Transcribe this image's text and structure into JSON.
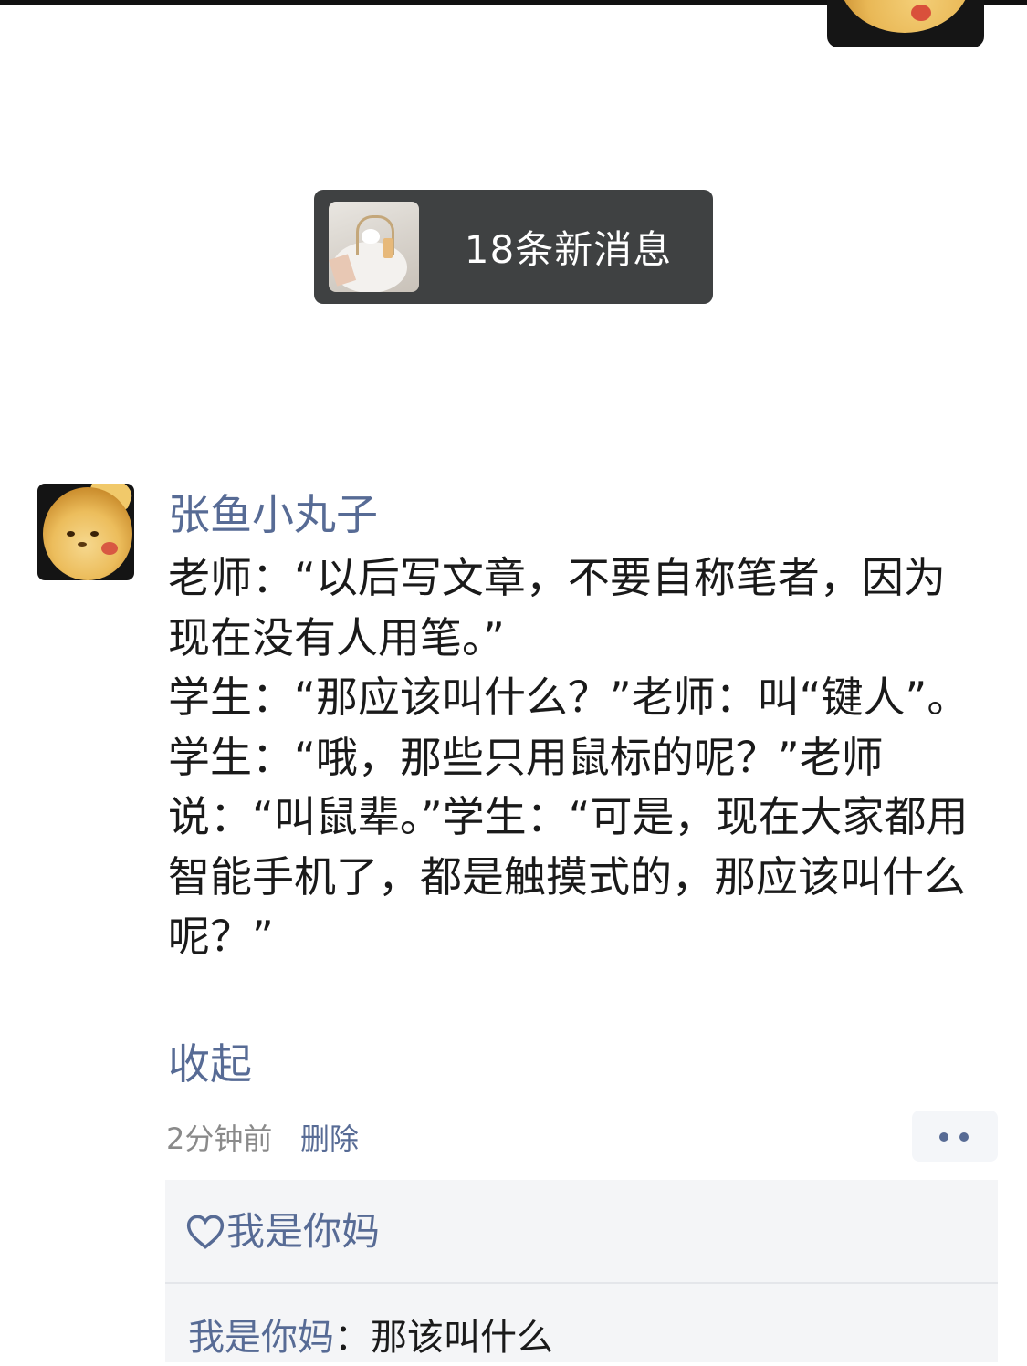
{
  "new_messages": {
    "text": "18条新消息"
  },
  "post": {
    "author": "张鱼小丸子",
    "text": "老师：“以后写文章，不要自称笔者，因为现在没有人用笔。”\n学生：“那应该叫什么？”老师：叫“键人”。\n学生：“哦，那些只用鼠标的呢？”老师说：“叫鼠辈。”学生：“可是，现在大家都用智能手机了，都是触摸式的，那应该叫什么呢？”",
    "collapse_label": "收起",
    "time": "2分钟前",
    "delete_label": "删除"
  },
  "likes": {
    "names": "我是你妈"
  },
  "comments": [
    {
      "author": "我是你妈",
      "separator": "：",
      "text": "那该叫什么"
    }
  ],
  "colors": {
    "link_blue": "#576b95",
    "text": "#1a1a1a",
    "time_gray": "#8a8a8a",
    "interact_bg": "#f4f5f7",
    "banner_bg": "#3f4142"
  },
  "icons": {
    "like": "heart-outline-icon",
    "more": "two-dots-more-icon"
  }
}
